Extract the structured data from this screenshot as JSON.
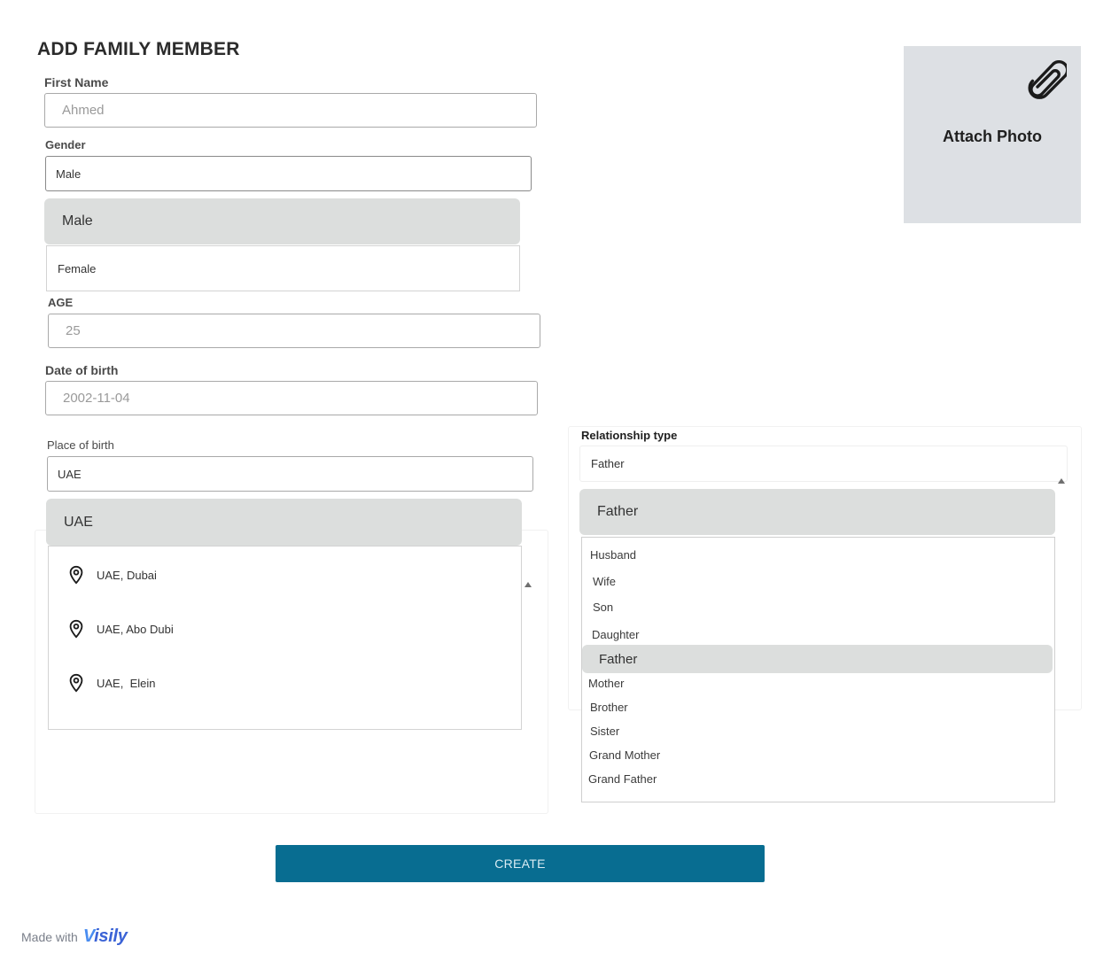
{
  "title": "ADD FAMILY MEMBER",
  "first_name": {
    "label": "First Name",
    "placeholder": "Ahmed"
  },
  "gender": {
    "label": "Gender",
    "value": "Male",
    "options": [
      "Male",
      "Female"
    ]
  },
  "age": {
    "label": "AGE",
    "placeholder": "25"
  },
  "dob": {
    "label": "Date of birth",
    "placeholder": "2002-11-04"
  },
  "place_of_birth": {
    "label": "Place of birth",
    "value": "UAE",
    "highlighted": "UAE",
    "suggestions": [
      "UAE, Dubai",
      "UAE, Abo Dubi",
      "UAE,  Elein"
    ]
  },
  "photo": {
    "label": "Attach Photo",
    "icon": "paperclip-icon"
  },
  "relationship": {
    "label": "Relationship type",
    "value": "Father",
    "highlighted": "Father",
    "options": [
      "Husband",
      "Wife",
      "Son",
      "Daughter",
      "Father",
      "Mother",
      "Brother",
      "Sister",
      "Grand Mother",
      "Grand Father"
    ]
  },
  "create_label": "CREATE",
  "footer": {
    "made_with": "Made with",
    "brand_v": "V",
    "brand_rest": "isily"
  },
  "colors": {
    "primary": "#086d91",
    "highlight": "#dcdedd",
    "photo_bg": "#dde0e4",
    "brand": "#3b63d6"
  }
}
